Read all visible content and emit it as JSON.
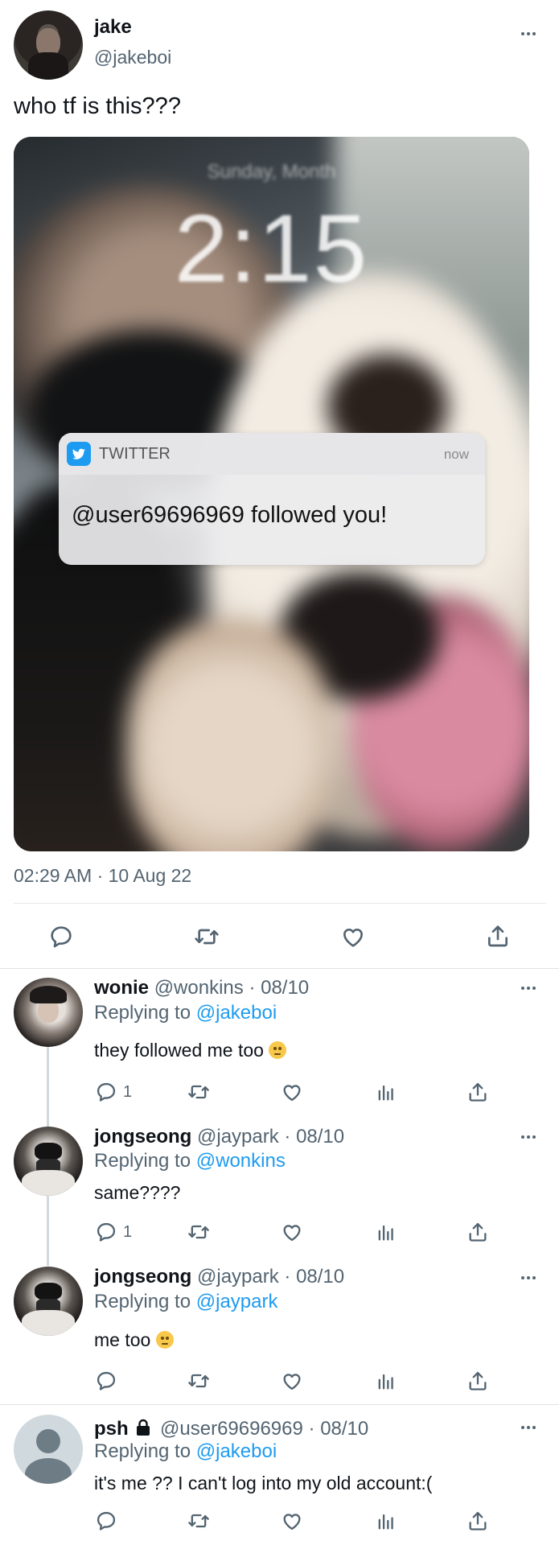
{
  "main_tweet": {
    "name": "jake",
    "handle": "@jakeboi",
    "text": "who tf is this???",
    "timestamp": "02:29 AM · 10 Aug 22",
    "screenshot": {
      "lock_date": "Sunday, Month",
      "lock_time": "2:15",
      "app_label": "TWITTER",
      "notif_time": "now",
      "notif_handle": "@user69696969",
      "notif_suffix": " followed you!"
    }
  },
  "replies": [
    {
      "name": "wonie",
      "handle": "@wonkins",
      "date": "· 08/10",
      "replying_prefix": "Replying to ",
      "replying_to": "@jakeboi",
      "text": "they followed me too",
      "reply_count": "1",
      "emoji": "thinking-face"
    },
    {
      "name": "jongseong",
      "handle": "@jaypark",
      "date": "· 08/10",
      "replying_prefix": "Replying to ",
      "replying_to": "@wonkins",
      "text": "same????",
      "reply_count": "1"
    },
    {
      "name": "jongseong",
      "handle": "@jaypark",
      "date": "· 08/10",
      "replying_prefix": "Replying to ",
      "replying_to": "@jaypark",
      "text": "me too",
      "reply_count": "",
      "emoji": "thinking-face"
    },
    {
      "name": "psh",
      "handle": "@user69696969",
      "date": "· 08/10",
      "replying_prefix": "Replying to ",
      "replying_to": "@jakeboi",
      "text": "it's me ?? I can't log into my old account:(",
      "reply_count": "",
      "locked": true
    }
  ],
  "colors": {
    "accent": "#1d9bf0",
    "muted": "#536471",
    "divider": "#e4e7ea"
  }
}
